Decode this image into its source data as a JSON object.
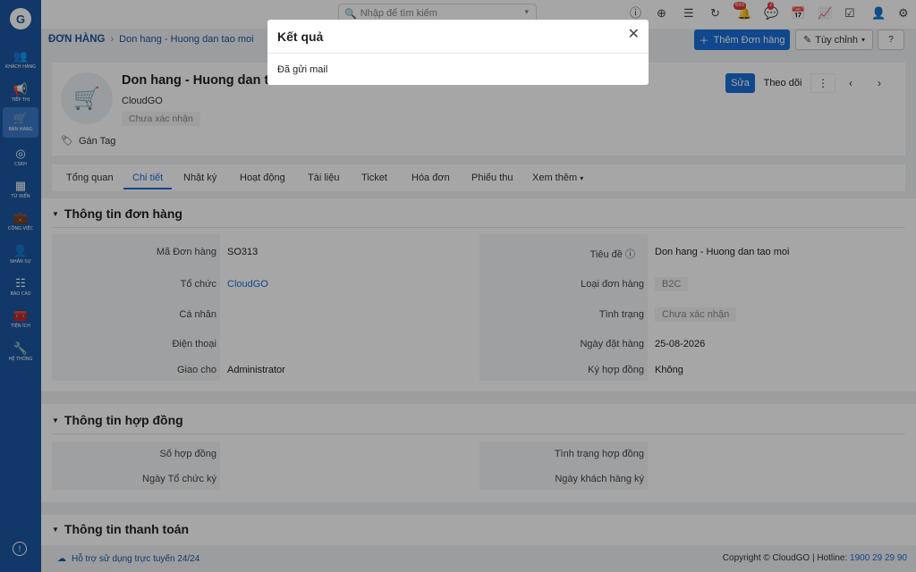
{
  "sidebar": {
    "items": [
      {
        "label": "KHÁCH HÀNG",
        "icon": "users-icon"
      },
      {
        "label": "TIẾP THỊ",
        "icon": "megaphone-icon"
      },
      {
        "label": "BÁN HÀNG",
        "icon": "cart-icon",
        "active": true
      },
      {
        "label": "CSKH",
        "icon": "support-icon"
      },
      {
        "label": "TỪ ĐIỂN",
        "icon": "dictionary-icon"
      },
      {
        "label": "CÔNG VIỆC",
        "icon": "briefcase-icon"
      },
      {
        "label": "NHÂN SỰ",
        "icon": "person-icon"
      },
      {
        "label": "BÁO CÁO",
        "icon": "report-icon"
      },
      {
        "label": "TIỆN ÍCH",
        "icon": "toolbox-icon"
      },
      {
        "label": "HỆ THỐNG",
        "icon": "wrench-icon"
      }
    ]
  },
  "topbar": {
    "search_placeholder": "Nhập để tìm kiếm",
    "notification_count": "693",
    "chat_count": "2"
  },
  "breadcrumb": {
    "module": "ĐƠN HÀNG",
    "current": "Don hang - Huong dan tao moi"
  },
  "actions": {
    "add_label": "Thêm Đơn hàng",
    "customize_label": "Tùy chỉnh"
  },
  "record": {
    "title": "Don hang - Huong dan tao moi",
    "org": "CloudGO",
    "status": "Chưa xác nhận",
    "tag_label": "Gán Tag",
    "edit_label": "Sửa",
    "follow_label": "Theo dõi"
  },
  "tabs": [
    "Tổng quan",
    "Chi tiết",
    "Nhật ký",
    "Hoạt động",
    "Tài liệu",
    "Ticket",
    "Hóa đơn",
    "Phiếu thu",
    "Xem thêm"
  ],
  "section_order": {
    "title": "Thông tin đơn hàng",
    "left": [
      {
        "label": "Mã Đơn hàng",
        "value": "SO313"
      },
      {
        "label": "Tổ chức",
        "value": "CloudGO"
      },
      {
        "label": "Cá nhân",
        "value": ""
      },
      {
        "label": "Điện thoại",
        "value": ""
      },
      {
        "label": "Giao cho",
        "value": "Administrator"
      }
    ],
    "right": [
      {
        "label": "Tiêu đề",
        "value": "Don hang - Huong dan tao moi"
      },
      {
        "label": "Loại đơn hàng",
        "value": "B2C"
      },
      {
        "label": "Tình trạng",
        "value": "Chưa xác nhận"
      },
      {
        "label": "Ngày đặt hàng",
        "value": "25-08-2026"
      },
      {
        "label": "Ký hợp đồng",
        "value": "Không"
      }
    ]
  },
  "section_contract": {
    "title": "Thông tin hợp đồng",
    "left": [
      {
        "label": "Số hợp đồng",
        "value": ""
      },
      {
        "label": "Ngày Tổ chức ký",
        "value": ""
      }
    ],
    "right": [
      {
        "label": "Tình trạng hợp đồng",
        "value": ""
      },
      {
        "label": "Ngày khách hàng ký",
        "value": ""
      }
    ]
  },
  "section_payment": {
    "title": "Thông tin thanh toán"
  },
  "footer": {
    "support": "Hỗ trợ sử dụng trực tuyến 24/24",
    "copyright": "Copyright © CloudGO | Hotline: ",
    "hotline": "1900 29 29 90"
  },
  "modal": {
    "title": "Kết quả",
    "message": "Đã gửi mail"
  }
}
